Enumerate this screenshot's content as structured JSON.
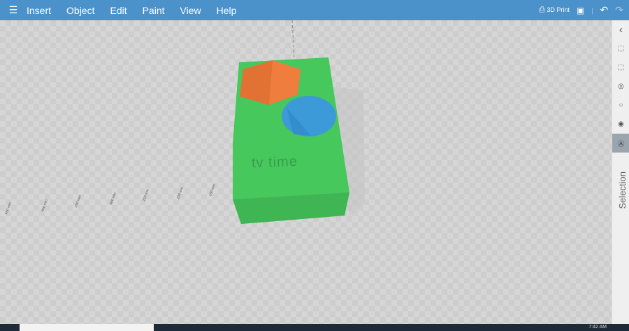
{
  "menu": {
    "items": [
      "Insert",
      "Object",
      "Edit",
      "Paint",
      "View",
      "Help"
    ]
  },
  "toolbar": {
    "print_label": "3D Print",
    "icons": [
      "3d-print-icon",
      "save-icon",
      "undo-icon",
      "redo-icon"
    ]
  },
  "model": {
    "text": "tv time",
    "colors": {
      "base": "#44c55a",
      "hexagon": "#ee7d3c",
      "cylinder": "#3d9bd8"
    }
  },
  "rulers": [
    "450 mm",
    "400 mm",
    "350 mm",
    "300 mm",
    "250 mm",
    "200 mm",
    "150 mm"
  ],
  "side": {
    "label": "Selection",
    "collapse": "‹"
  },
  "taskbar": {
    "time": "7:42 AM"
  }
}
